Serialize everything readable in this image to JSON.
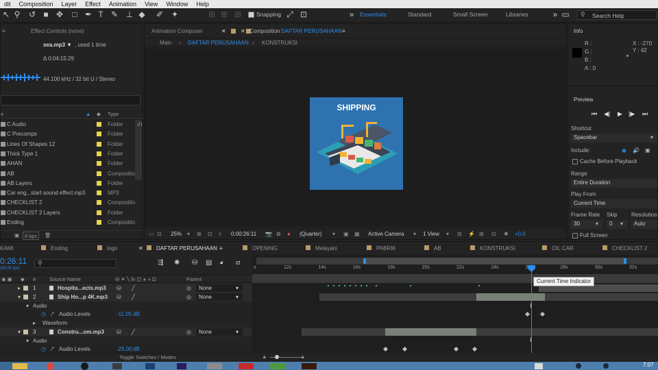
{
  "menu": [
    "dit",
    "Composition",
    "Layer",
    "Effect",
    "Animation",
    "View",
    "Window",
    "Help"
  ],
  "toolbar": {
    "snapping": "Snapping",
    "workspaces": [
      "Essentials",
      "Standard",
      "Small Screen",
      "Libraries"
    ],
    "search": "Search Help"
  },
  "project": {
    "tab": "Effect Controls (none)",
    "file": "sea.mp3",
    "used": ", used 1 time",
    "duration": "Δ 0:04:15:29",
    "audio": "44.100 kHz / 32 bit U / Stereo",
    "col_type": "Type",
    "items": [
      {
        "name": "C Audio",
        "type": "Folder"
      },
      {
        "name": "C Precomps",
        "type": "Folder"
      },
      {
        "name": "Lines Of Shapes 12",
        "type": "Folder"
      },
      {
        "name": "Thick Type 1",
        "type": "Folder"
      },
      {
        "name": "AHAN",
        "type": "Folder"
      },
      {
        "name": "AB",
        "type": "Compositio"
      },
      {
        "name": "AB Layers",
        "type": "Folder"
      },
      {
        "name": "Car eng...start sound effect.mp3",
        "type": "MP3"
      },
      {
        "name": "CHECKLIST 2",
        "type": "Compositio"
      },
      {
        "name": "CHECKLIST 2 Layers",
        "type": "Folder"
      },
      {
        "name": "Ending",
        "type": "Compositio"
      }
    ],
    "bpc": "8 bpc"
  },
  "composition": {
    "tab_anim": "Animation Composer",
    "tab_comp_prefix": "Composition",
    "tab_comp_name": "DAFTAR PERUSAHAAN",
    "crumbs": [
      "Main",
      "DAFTAR PERUSAHAAN",
      "KONSTRUKSI"
    ],
    "artwork_title": "SHIPPING",
    "footer": {
      "zoom": "25%",
      "time": "0:00:26:11",
      "quality": "(Quarter)",
      "camera": "Active Camera",
      "view": "1 View",
      "exposure": "+0.0"
    }
  },
  "info": {
    "tab": "Info",
    "r": "R :",
    "g": "G :",
    "b": "B :",
    "a": "A : 0",
    "x": "X : -270",
    "y": "Y : 42"
  },
  "preview": {
    "tab": "Preview",
    "shortcut_label": "Shortcut",
    "shortcut": "Spacebar",
    "include": "Include:",
    "cache": "Cache Before Playback",
    "range_label": "Range",
    "range": "Entire Duration",
    "playfrom_label": "Play From",
    "playfrom": "Current Time",
    "framerate_label": "Frame Rate",
    "skip_label": "Skip",
    "resolution_label": "Resolution",
    "framerate": "30",
    "skip": "0",
    "resolution": "Auto",
    "fullscreen": "Full Screen"
  },
  "timeline": {
    "tabs": [
      "KAMI",
      "Ending",
      "logo",
      "DAFTAR PERUSAHAAN",
      "OPENING",
      "Melayani",
      "PABRIK",
      "AB",
      "KONSTRUKSI",
      "OIL CAR",
      "CHECKLIST 2"
    ],
    "time": "0:26:11",
    "fps": "(30.00 fps)",
    "col_source": "Source Name",
    "col_parent": "Parent",
    "ruler": [
      "s",
      "12s",
      "14s",
      "16s",
      "18s",
      "20s",
      "22s",
      "24s",
      "26s",
      "28s",
      "30s",
      "32s"
    ],
    "tooltip": "Current Time Indicator",
    "layers": [
      {
        "num": "1",
        "name": "Hospita...ects.mp3",
        "parent": "None"
      },
      {
        "num": "2",
        "name": "Ship Ho...p 4K.mp3",
        "parent": "None"
      },
      {
        "sub": "Audio"
      },
      {
        "prop": "Audio Levels",
        "value": "-11.05",
        "unit": "dB"
      },
      {
        "sub": "Waveform"
      },
      {
        "num": "3",
        "name": "Constru...om.mp3",
        "parent": "None"
      },
      {
        "sub": "Audio"
      },
      {
        "prop": "Audio Levels",
        "value": "-25.00",
        "unit": "dB"
      }
    ],
    "toggle": "Toggle Switches / Modes"
  },
  "taskbar": {
    "clock": "7:07"
  }
}
